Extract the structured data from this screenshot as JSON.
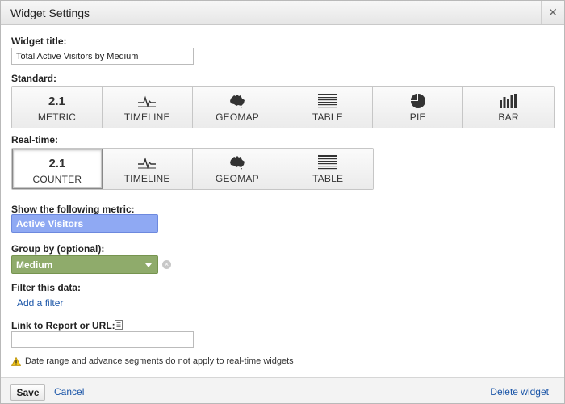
{
  "dialog": {
    "title": "Widget Settings",
    "close_glyph": "✕"
  },
  "widget_title": {
    "label": "Widget title:",
    "value": "Total Active Visitors by Medium"
  },
  "standard": {
    "label": "Standard:",
    "buttons": [
      {
        "label": "METRIC",
        "number": "2.1",
        "icon": "metric-icon"
      },
      {
        "label": "TIMELINE",
        "icon": "timeline-icon"
      },
      {
        "label": "GEOMAP",
        "icon": "geomap-icon"
      },
      {
        "label": "TABLE",
        "icon": "table-icon"
      },
      {
        "label": "PIE",
        "icon": "pie-icon"
      },
      {
        "label": "BAR",
        "icon": "bar-chart-icon"
      }
    ]
  },
  "realtime": {
    "label": "Real-time:",
    "selected": "COUNTER",
    "buttons": [
      {
        "label": "COUNTER",
        "number": "2.1",
        "icon": "counter-icon"
      },
      {
        "label": "TIMELINE",
        "icon": "timeline-icon"
      },
      {
        "label": "GEOMAP",
        "icon": "geomap-icon"
      },
      {
        "label": "TABLE",
        "icon": "table-icon"
      }
    ]
  },
  "metric": {
    "label": "Show the following metric:",
    "value": "Active Visitors",
    "color": "#8fa9f3"
  },
  "group_by": {
    "label": "Group by (optional):",
    "value": "Medium",
    "color": "#8fab6b",
    "clear_glyph": "×"
  },
  "filter": {
    "label": "Filter this data:",
    "link": "Add a filter"
  },
  "link_to": {
    "label": "Link to Report or URL:",
    "value": ""
  },
  "note": {
    "text": "Date range and advance segments do not apply to real-time widgets",
    "warning_glyph": "!"
  },
  "footer": {
    "save_label": "Save",
    "cancel_label": "Cancel",
    "delete_label": "Delete widget"
  },
  "colors": {
    "link": "#1a55a8",
    "titlebar": "#ececec"
  }
}
